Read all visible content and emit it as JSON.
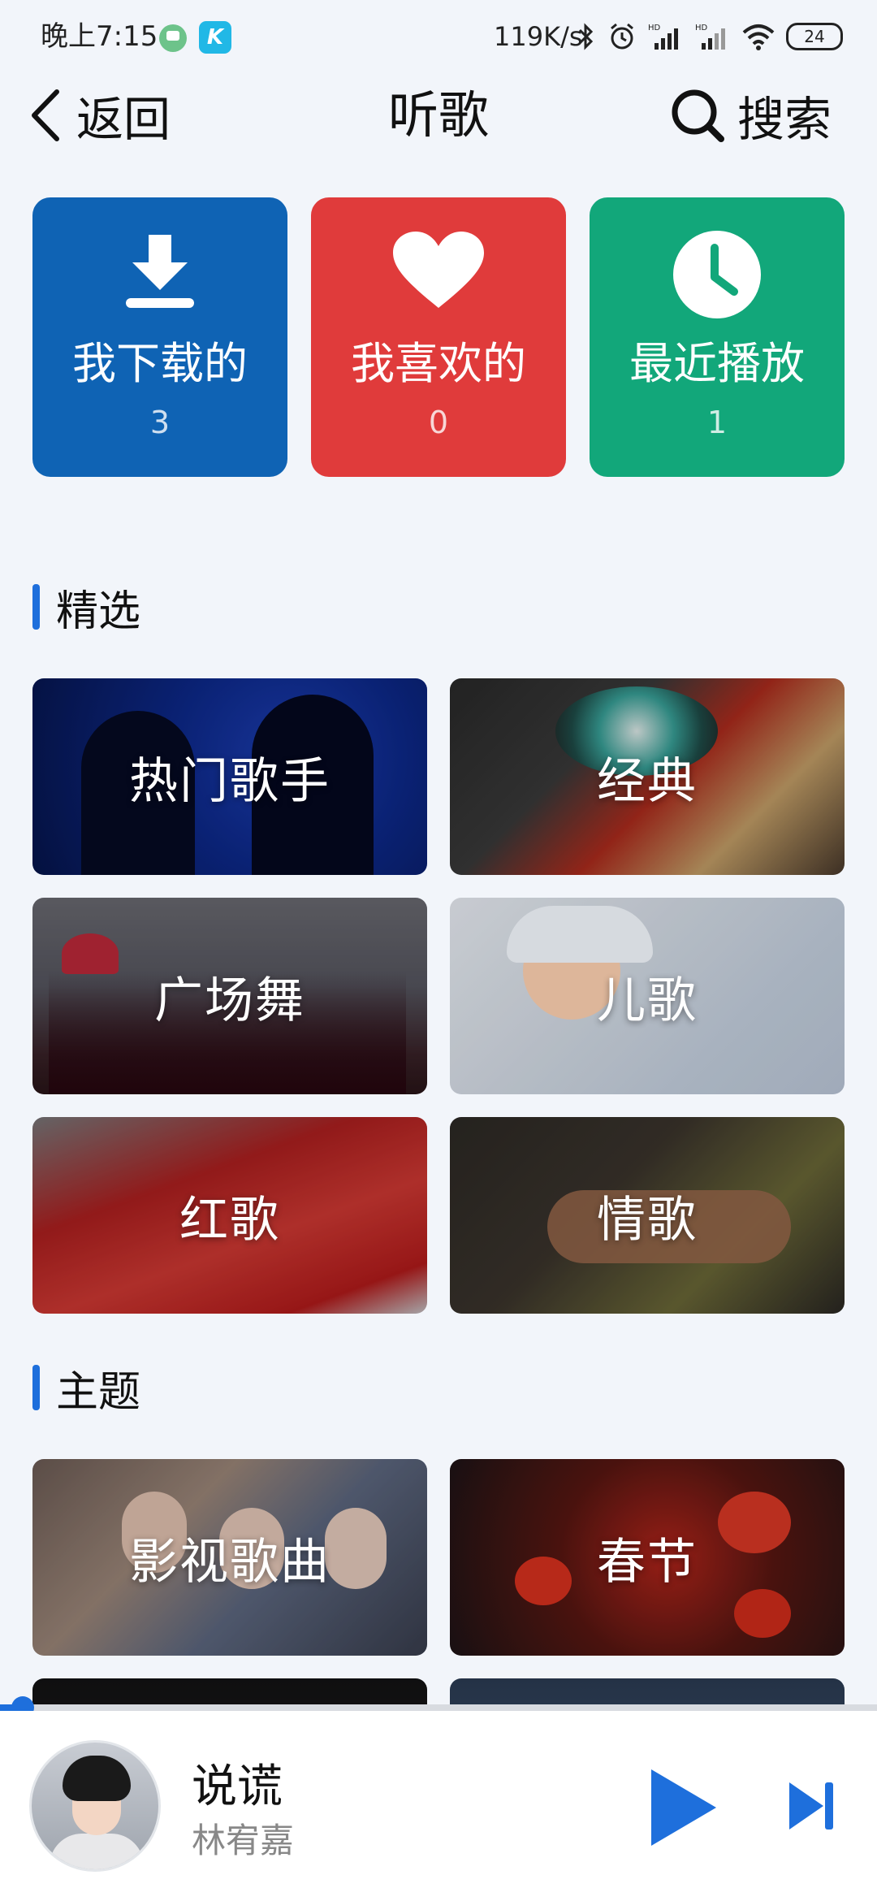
{
  "status_bar": {
    "time": "晚上7:15",
    "net_speed": "119K/s",
    "battery": "24"
  },
  "header": {
    "back_label": "返回",
    "title": "听歌",
    "search_label": "搜索"
  },
  "quick_tiles": [
    {
      "label": "我下载的",
      "count": "3",
      "icon": "download-icon",
      "color": "#0f63b4"
    },
    {
      "label": "我喜欢的",
      "count": "0",
      "icon": "heart-icon",
      "color": "#e03b3b"
    },
    {
      "label": "最近播放",
      "count": "1",
      "icon": "clock-icon",
      "color": "#12a77a"
    }
  ],
  "sections": {
    "featured_title": "精选",
    "theme_title": "主题"
  },
  "featured": [
    {
      "label": "热门歌手"
    },
    {
      "label": "经典"
    },
    {
      "label": "广场舞"
    },
    {
      "label": "儿歌"
    },
    {
      "label": "红歌"
    },
    {
      "label": "情歌"
    }
  ],
  "themes": [
    {
      "label": "影视歌曲"
    },
    {
      "label": "春节"
    }
  ],
  "player": {
    "song_title": "说谎",
    "artist": "林宥嘉",
    "progress": 0.02,
    "accent": "#1e6fdc"
  }
}
